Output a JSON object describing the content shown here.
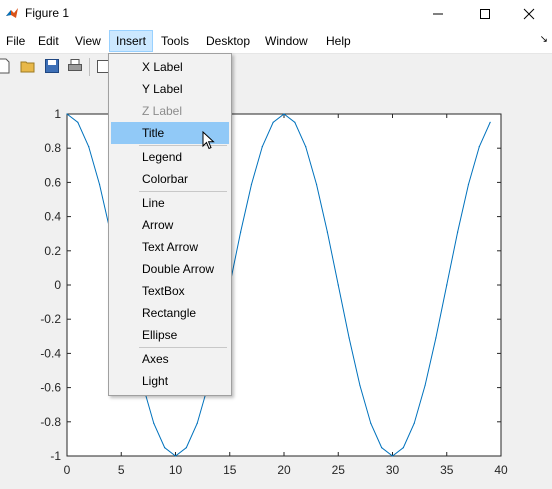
{
  "window": {
    "title": "Figure 1",
    "controls": {
      "minimize": "—",
      "maximize": "☐",
      "close": "✕"
    }
  },
  "menubar": {
    "items": [
      {
        "label": "File"
      },
      {
        "label": "Edit"
      },
      {
        "label": "View"
      },
      {
        "label": "Insert",
        "active": true
      },
      {
        "label": "Tools"
      },
      {
        "label": "Desktop"
      },
      {
        "label": "Window"
      },
      {
        "label": "Help"
      }
    ],
    "dock_icon": "↘"
  },
  "toolbar": {
    "icons": [
      "new-figure-icon",
      "open-file-icon",
      "save-icon",
      "print-icon",
      "print-preview-icon"
    ]
  },
  "insert_menu": {
    "groups": [
      [
        {
          "label": "X Label"
        },
        {
          "label": "Y Label"
        },
        {
          "label": "Z Label",
          "disabled": true
        },
        {
          "label": "Title",
          "hover": true
        }
      ],
      [
        {
          "label": "Legend"
        },
        {
          "label": "Colorbar"
        }
      ],
      [
        {
          "label": "Line"
        },
        {
          "label": "Arrow"
        },
        {
          "label": "Text Arrow"
        },
        {
          "label": "Double Arrow"
        },
        {
          "label": "TextBox"
        },
        {
          "label": "Rectangle"
        },
        {
          "label": "Ellipse"
        }
      ],
      [
        {
          "label": "Axes"
        },
        {
          "label": "Light"
        }
      ]
    ]
  },
  "colors": {
    "line": "#0072bd",
    "menu_hover": "#91c9f7",
    "menubar_active": "#cce8ff"
  },
  "chart_data": {
    "type": "line",
    "title": "",
    "xlabel": "",
    "ylabel": "",
    "xlim": [
      0,
      40
    ],
    "ylim": [
      -1,
      1
    ],
    "xticks": [
      "0",
      "5",
      "10",
      "15",
      "20",
      "25",
      "30",
      "35",
      "40"
    ],
    "yticks": [
      "1",
      "0.8",
      "0.6",
      "0.4",
      "0.2",
      "0",
      "-0.2",
      "-0.4",
      "-0.6",
      "-0.8",
      "-1"
    ],
    "grid": false,
    "series": [
      {
        "x": [
          0,
          1,
          2,
          3,
          4,
          5,
          6,
          7,
          8,
          9,
          10,
          11,
          12,
          13,
          14,
          15,
          16,
          17,
          18,
          19,
          20,
          21,
          22,
          23,
          24,
          25,
          26,
          27,
          28,
          29,
          30,
          31,
          32,
          33,
          34,
          35,
          36,
          37,
          38,
          39
        ],
        "y": [
          1,
          0.951,
          0.809,
          0.588,
          0.309,
          0,
          -0.309,
          -0.588,
          -0.809,
          -0.951,
          -1,
          -0.951,
          -0.809,
          -0.588,
          -0.309,
          0,
          0.309,
          0.588,
          0.809,
          0.951,
          1,
          0.951,
          0.809,
          0.588,
          0.309,
          0,
          -0.309,
          -0.588,
          -0.809,
          -0.951,
          -1,
          -0.951,
          -0.809,
          -0.588,
          -0.309,
          0,
          0.309,
          0.588,
          0.809,
          0.951
        ]
      }
    ]
  }
}
